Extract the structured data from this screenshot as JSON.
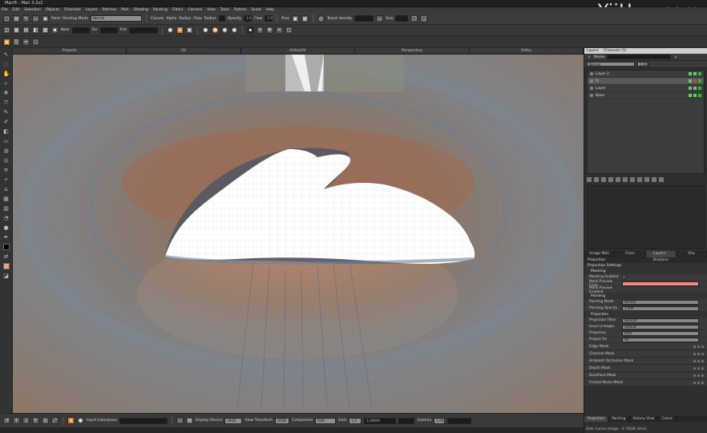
{
  "app": {
    "title": "Mari® - Mari 3.2v2",
    "watermark": "YiiHuu.com"
  },
  "menu": [
    "File",
    "Edit",
    "Selection",
    "Objects",
    "Channels",
    "Layers",
    "Patches",
    "Pain",
    "Shading",
    "Painting",
    "Filters",
    "Camera",
    "View",
    "Tools",
    "Python",
    "Scale",
    "Help"
  ],
  "toolbar1": {
    "paint_label": "Paint",
    "painting_mode_label": "Painting Mode",
    "painting_mode_value": "Normal",
    "canvas_label": "Canvas",
    "alpha_label": "Alpha",
    "radius_label": "Radius",
    "flow_label": "Flow",
    "radius2_label": "Radius",
    "opacity_label": "Opacity",
    "opacity_value": "1.0",
    "flow2_label": "Flow",
    "flow2_value": "1.0",
    "pres_label": "Pres",
    "tessel_label": "Tessel density",
    "size_label": "Size"
  },
  "toolbar2": {
    "near_label": "Near",
    "far_label": "Far",
    "fov_label": "FoV"
  },
  "viewport_tabs": [
    "Projects",
    "UV",
    "Ortho/UV",
    "Perspective",
    "Ortho"
  ],
  "layers_panel": {
    "header_tabs": [
      "Layers",
      "Channels (1)"
    ],
    "filter_label": "Name",
    "blend_mode": "Normal",
    "opacity_value": "1.000",
    "layers": [
      {
        "name": "Layer 2",
        "selected": false
      },
      {
        "name": "fs",
        "selected": true
      },
      {
        "name": "Layer",
        "selected": false
      },
      {
        "name": "Base",
        "selected": false
      }
    ]
  },
  "mid_tabs": [
    "Image Man",
    "Chan",
    "Layers - Displace",
    "Sha"
  ],
  "projection": {
    "panel_title": "Projection",
    "settings_title": "Projection Settings",
    "masking_section": "Masking",
    "masking_enabled_label": "Masking Enabled",
    "mask_preview_color_label": "Mask Preview Color",
    "mask_preview_enabled_label": "Mask Preview Enabled",
    "painting_section": "Painting",
    "painting_mode_label": "Painting Mode",
    "painting_mode_value": "Normal",
    "painting_opacity_label": "Painting Opacity",
    "painting_opacity_value": "1.000",
    "projection_section": "Projection",
    "projection_filter_label": "Projection Filter",
    "projection_filter_value": "Nearest",
    "issue_lineages_label": "Issue Lineages",
    "issue_lineages_value": "Default",
    "projection_label": "Projection",
    "projection_value": "Pixel",
    "project_on_label": "Project On",
    "project_on_value": "All",
    "masks": [
      "Edge Mask",
      "Channel Mask",
      "Ambient Occlusion Mask",
      "Depth Mask",
      "Backface Mask",
      "Fractal Noise Mask"
    ]
  },
  "bottom_right_tabs": [
    "Projection",
    "Painting",
    "History View",
    "Colors"
  ],
  "status": {
    "disk_cache": "Disk Cache Usage : 2.70GB (drm)"
  },
  "bottombar": {
    "input_colorspace_label": "Input Colorspace",
    "display_device_label": "Display Device",
    "display_device_value": "sRGB",
    "view_transform_label": "View Transform",
    "view_transform_value": "sRGB",
    "component_label": "Component",
    "component_value": "RGB",
    "gain_label": "Gain",
    "gain_value": "1.0",
    "gain_num": "1.00000",
    "gamma_label": "Gamma",
    "gamma_value": "1.00"
  },
  "colors": {
    "accent": "#d07a1e",
    "mask_preview": "#f08a7e",
    "viewport_bg": "#8a7a6c",
    "paint_shape": "#ffffff"
  }
}
